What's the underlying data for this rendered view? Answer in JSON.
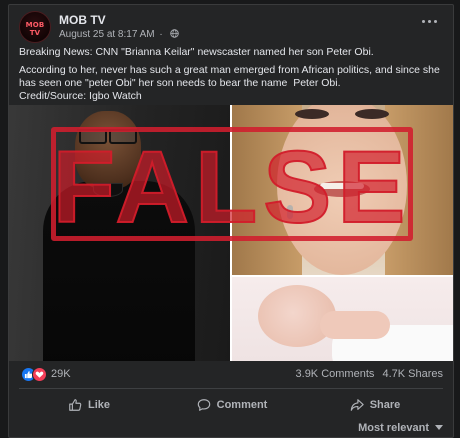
{
  "post": {
    "page_name": "MOB TV",
    "avatar_text": "MOB TV",
    "timestamp": "August 25 at 8:17 AM",
    "separator": "·",
    "text": {
      "line1": "Breaking News: CNN \"Brianna Keilar\" newscaster named her son Peter Obi.",
      "line2": "According to her, never has such a great man emerged from African politics, and since she has seen one \"peter Obi\" her son needs to bear the name  Peter Obi.",
      "line3": "Credit/Source: Igbo Watch"
    },
    "image": {
      "stamp_text": "FALSE",
      "stamp_color": "#d01e2d"
    }
  },
  "engagement": {
    "reactions_count": "29K",
    "comments": "3.9K Comments",
    "shares": "4.7K Shares"
  },
  "actions": {
    "like": "Like",
    "comment": "Comment",
    "share": "Share"
  },
  "sort": {
    "label": "Most relevant"
  },
  "colors": {
    "background": "#18191a",
    "card": "#242526",
    "text_primary": "#e4e6eb",
    "text_secondary": "#b0b3b8",
    "like_blue": "#1877f2",
    "love_red": "#f33e58"
  }
}
